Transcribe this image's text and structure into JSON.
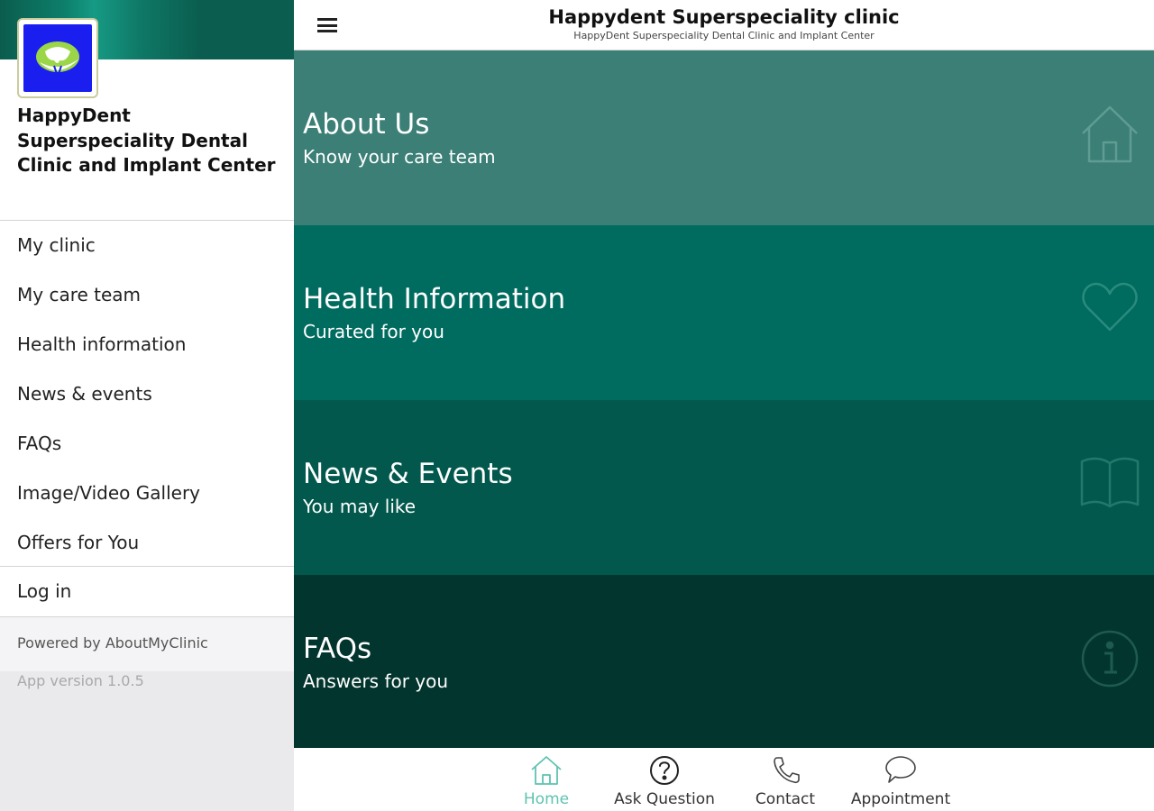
{
  "header": {
    "title": "Happydent Superspeciality clinic",
    "subtitle": "HappyDent Superspeciality Dental Clinic and Implant Center",
    "menu_icon": "hamburger-menu-icon"
  },
  "drawer": {
    "clinic_name": "HappyDent Superspeciality Dental Clinic and Implant Center",
    "menu_items": [
      {
        "label": "My clinic"
      },
      {
        "label": "My care team"
      },
      {
        "label": "Health information"
      },
      {
        "label": "News & events"
      },
      {
        "label": "FAQs"
      },
      {
        "label": "Image/Video Gallery"
      },
      {
        "label": "Offers for You"
      }
    ],
    "login_label": "Log in",
    "powered_by": "Powered by AboutMyClinic",
    "app_version": "App version 1.0.5"
  },
  "tiles": [
    {
      "title": "About Us",
      "subtitle": "Know your care team",
      "icon": "home-icon",
      "color": "#3b7f76"
    },
    {
      "title": "Health Information",
      "subtitle": "Curated for you",
      "icon": "heart-icon",
      "color": "#006b5f"
    },
    {
      "title": "News & Events",
      "subtitle": "You may like",
      "icon": "book-icon",
      "color": "#02584c"
    },
    {
      "title": "FAQs",
      "subtitle": "Answers for you",
      "icon": "info-icon",
      "color": "#02352e"
    }
  ],
  "tabbar": {
    "items": [
      {
        "label": "Home",
        "icon": "home-icon",
        "active": true
      },
      {
        "label": "Ask Question",
        "icon": "question-icon",
        "active": false
      },
      {
        "label": "Contact",
        "icon": "phone-icon",
        "active": false
      },
      {
        "label": "Appointment",
        "icon": "chat-bubble-icon",
        "active": false
      }
    ],
    "active_color": "#5fc3b0"
  }
}
